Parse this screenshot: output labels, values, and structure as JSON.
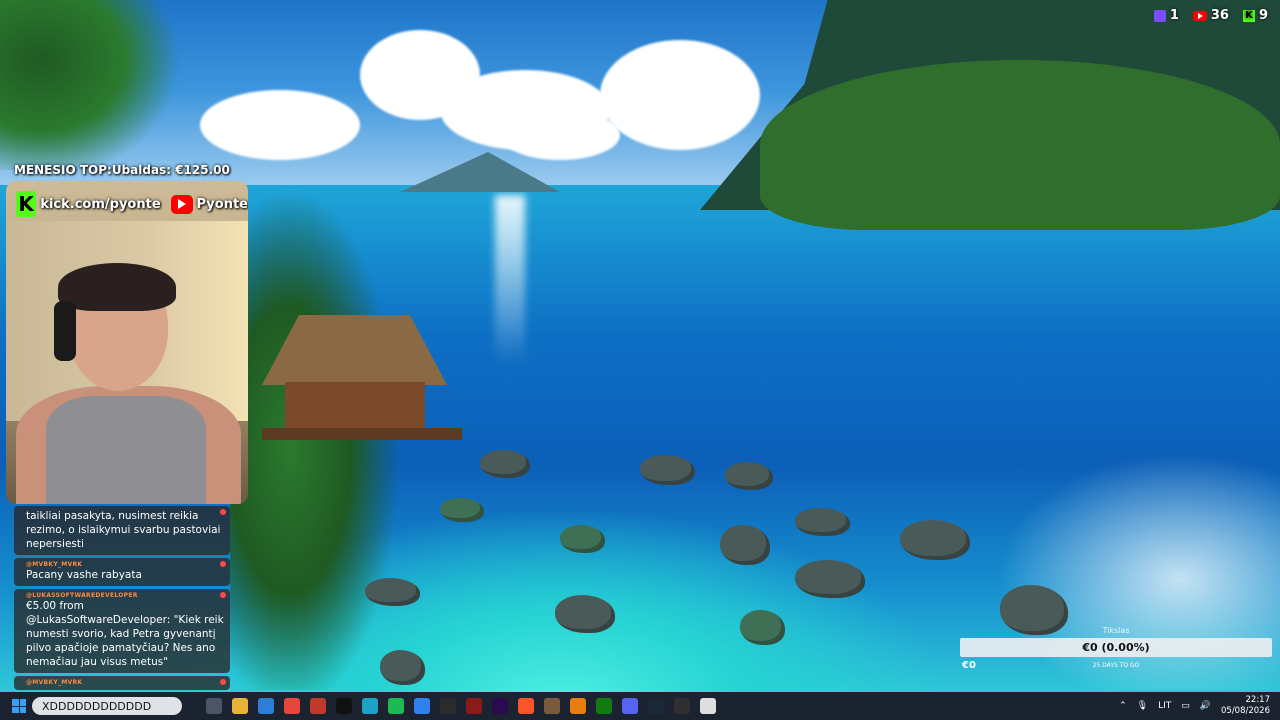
{
  "overlay": {
    "top_donor": "MENESIO TOP:Ubaldas: €125.00",
    "banner": {
      "kick_url": "kick.com/pyonte",
      "youtube_name": "Pyonte"
    },
    "counters": [
      {
        "icon": "twitch-viewers-icon",
        "color": "#7b4bff",
        "value": "1"
      },
      {
        "icon": "youtube-viewers-icon",
        "color": "#ff0000",
        "value": "36"
      },
      {
        "icon": "kick-viewers-icon",
        "color": "#53fc18",
        "value": "9"
      }
    ]
  },
  "chat": {
    "messages": [
      {
        "name": "",
        "text": "taikliai pasakyta, nusimest reikia rezimo, o islaikymui svarbu pastoviai nepersiesti"
      },
      {
        "name": "@MVBKY_MVRK",
        "text": "Pacany vashe rabyata"
      },
      {
        "name": "@LUKASSOFTWAREDEVELOPER",
        "text": "€5.00 from @LukasSoftwareDeveloper: \"Kiek reik numesti svorio, kad Petra gyvenantį pilvo apačioje pamatyčiau? Nes ano nemačiau jau visus metus\""
      },
      {
        "name": "@MVBKY_MVRK",
        "text": ""
      }
    ]
  },
  "goal": {
    "title": "Tikslas",
    "value": "€0 (0.00%)",
    "start": "€0",
    "remaining": "25 DAYS TO GO"
  },
  "taskbar": {
    "search_text": "XDDDDDDDDDDDD",
    "apps": [
      {
        "icon": "task-view-icon",
        "color": "#4a5568"
      },
      {
        "icon": "file-explorer-icon",
        "color": "#e8b339"
      },
      {
        "icon": "microsoft-store-icon",
        "color": "#2d7fd8"
      },
      {
        "icon": "chrome-icon",
        "color": "#e8453c"
      },
      {
        "icon": "media-app-icon",
        "color": "#c0392b"
      },
      {
        "icon": "capcut-icon",
        "color": "#111111"
      },
      {
        "icon": "edge-icon",
        "color": "#1da1c7"
      },
      {
        "icon": "spotify-icon",
        "color": "#1db954"
      },
      {
        "icon": "photos-icon",
        "color": "#2f80ed"
      },
      {
        "icon": "game-app-icon",
        "color": "#2b2b2b"
      },
      {
        "icon": "media-player-icon",
        "color": "#8b1a1a"
      },
      {
        "icon": "premiere-icon",
        "color": "#2a0a50"
      },
      {
        "icon": "brave-icon",
        "color": "#fb542b"
      },
      {
        "icon": "archive-icon",
        "color": "#7a5a3a"
      },
      {
        "icon": "blender-icon",
        "color": "#e87d0d"
      },
      {
        "icon": "xbox-icon",
        "color": "#107c10"
      },
      {
        "icon": "discord-icon",
        "color": "#5865f2"
      },
      {
        "icon": "steam-icon",
        "color": "#1b2838"
      },
      {
        "icon": "obs-icon",
        "color": "#302e31"
      },
      {
        "icon": "notes-icon",
        "color": "#dddddd"
      }
    ],
    "tray": {
      "language": "LIT",
      "time": "22:17",
      "date": "05/08/2026"
    }
  }
}
